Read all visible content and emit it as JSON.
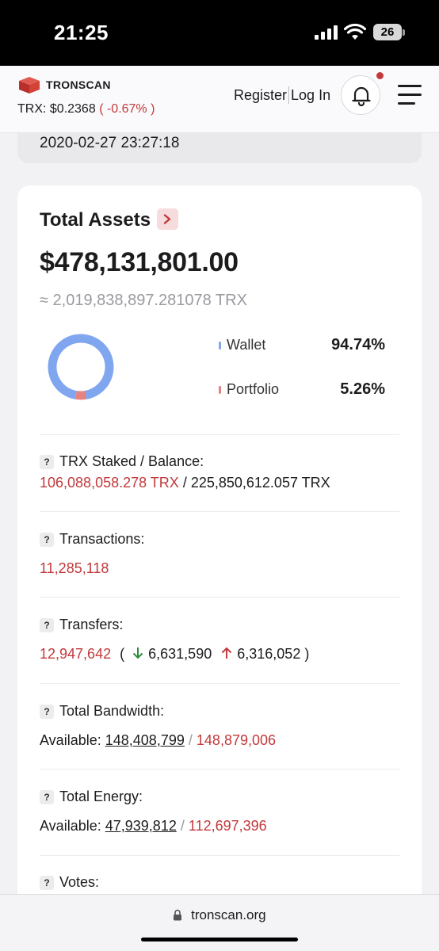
{
  "status_bar": {
    "time": "21:25",
    "battery": "26"
  },
  "header": {
    "logo_text": "TRONSCAN",
    "price_label": "TRX: $0.2368",
    "price_change": "( -0.67% )",
    "register": "Register",
    "login": "Log In"
  },
  "date_card": {
    "date": "2020-02-27 23:27:18"
  },
  "assets": {
    "title": "Total Assets",
    "value": "$478,131,801.00",
    "trx": "≈ 2,019,838,897.281078 TRX",
    "wallet_label": "Wallet",
    "wallet_pct": "94.74%",
    "portfolio_label": "Portfolio",
    "portfolio_pct": "5.26%",
    "wallet_fraction": 0.9474,
    "portfolio_fraction": 0.0526,
    "wallet_color": "#7fa6ee",
    "portfolio_color": "#e8827f"
  },
  "stats": {
    "staked_label": "TRX Staked / Balance:",
    "staked_value": "106,088,058.278 TRX",
    "balance_value": "/ 225,850,612.057 TRX",
    "tx_label": "Transactions:",
    "tx_value": "11,285,118",
    "transfers_label": "Transfers:",
    "transfers_value": "12,947,642",
    "transfers_open": "(",
    "transfers_in": "6,631,590",
    "transfers_out": "6,316,052",
    "transfers_close": ")",
    "bandwidth_label": "Total Bandwidth:",
    "available_label": "Available:",
    "bandwidth_available": "148,408,799",
    "bandwidth_total": "148,879,006",
    "energy_label": "Total Energy:",
    "energy_available": "47,939,812",
    "energy_total": "112,697,396",
    "votes_label": "Votes:",
    "slash": "/",
    "q": "?"
  },
  "browser": {
    "url": "tronscan.org"
  }
}
